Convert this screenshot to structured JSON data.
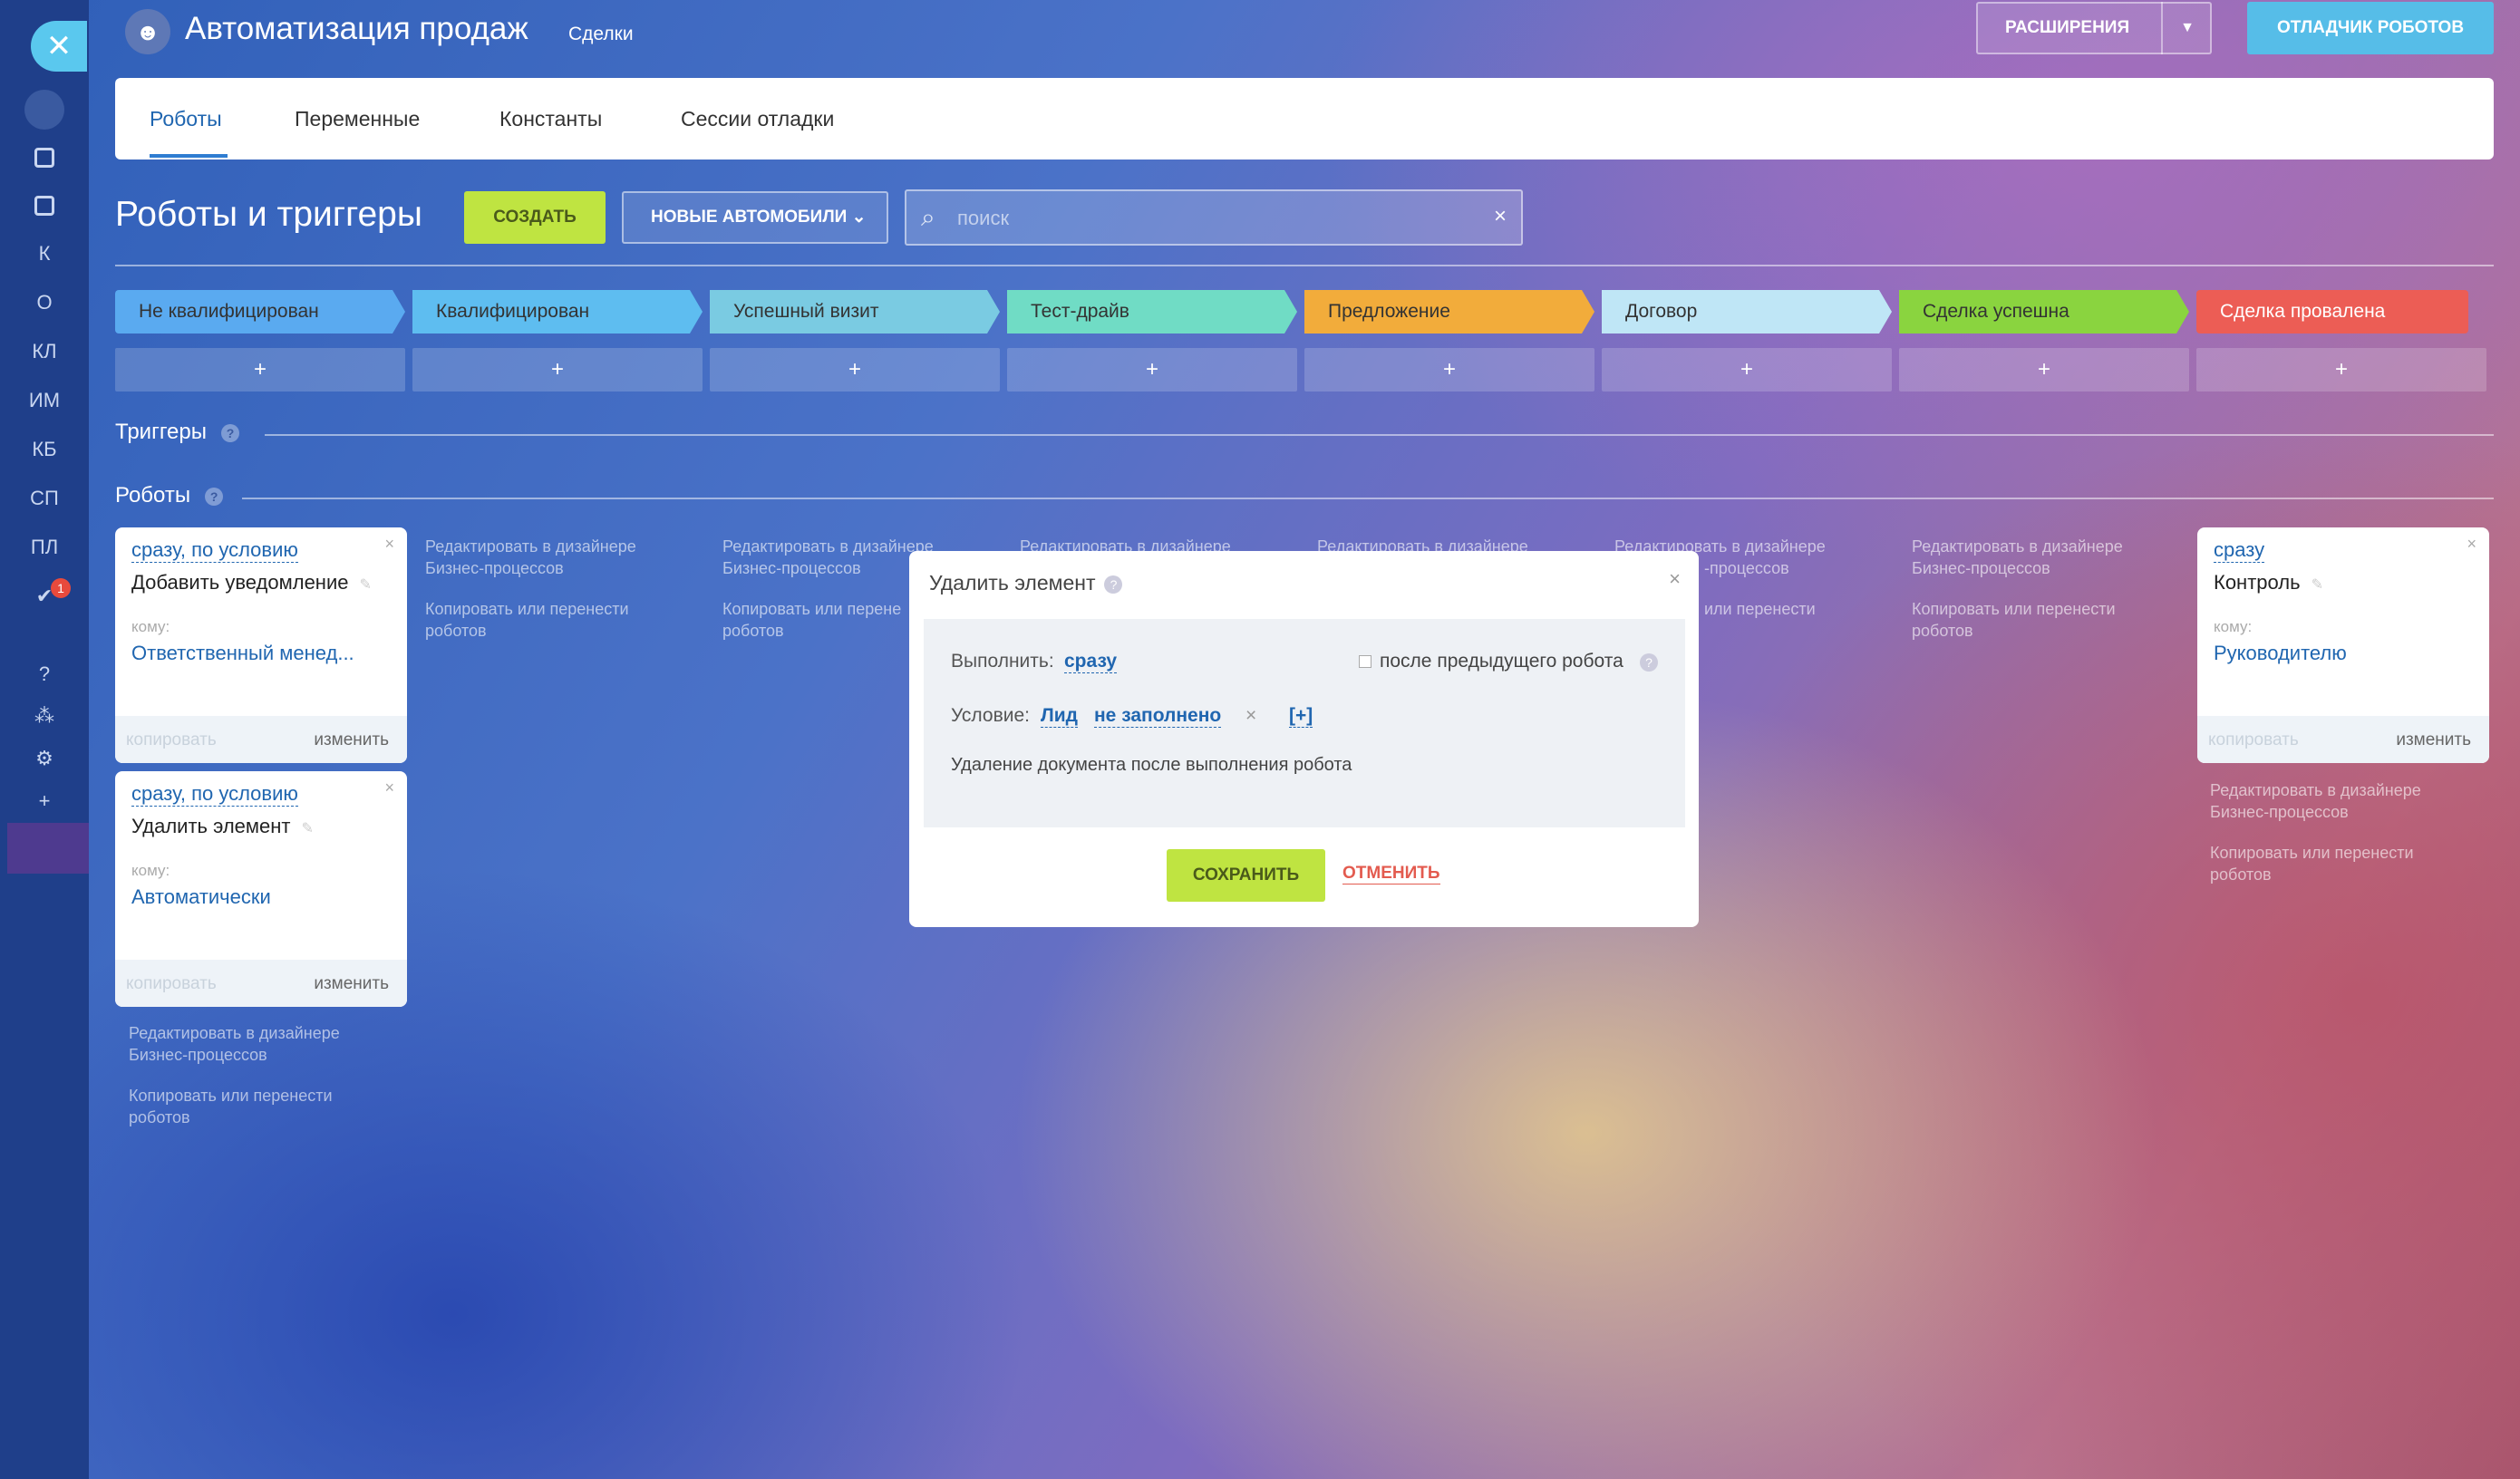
{
  "header": {
    "title": "Автоматизация продаж",
    "subtitle": "Сделки",
    "extensions_label": "РАСШИРЕНИЯ",
    "debugger_label": "ОТЛАДЧИК РОБОТОВ"
  },
  "sidebar": {
    "items": [
      "К",
      "О",
      "КЛ",
      "ИМ",
      "КБ",
      "СП",
      "ПЛ"
    ],
    "badge": "1"
  },
  "tabs": [
    {
      "label": "Роботы",
      "active": true
    },
    {
      "label": "Переменные",
      "active": false
    },
    {
      "label": "Константы",
      "active": false
    },
    {
      "label": "Сессии отладки",
      "active": false
    }
  ],
  "toolbar": {
    "section_title": "Роботы и триггеры",
    "create_label": "СОЗДАТЬ",
    "pipeline_label": "НОВЫЕ АВТОМОБИЛИ",
    "search_placeholder": "поиск"
  },
  "stages": [
    {
      "label": "Не квалифицирован",
      "color": "#5aaaf0"
    },
    {
      "label": "Квалифицирован",
      "color": "#5ebdf0"
    },
    {
      "label": "Успешный визит",
      "color": "#7acbe2"
    },
    {
      "label": "Тест-драйв",
      "color": "#70dcc5"
    },
    {
      "label": "Предложение",
      "color": "#f2ac3b"
    },
    {
      "label": "Договор",
      "color": "#bfe6f6"
    },
    {
      "label": "Сделка успешна",
      "color": "#8ad43f"
    },
    {
      "label": "Сделка провалена",
      "color": "#ec5d55"
    }
  ],
  "add_symbol": "+",
  "triggers_label": "Триггеры",
  "robots_label": "Роботы",
  "robots": [
    {
      "condition": "сразу, по условию",
      "name": "Добавить уведомление",
      "to_label": "кому:",
      "to": "Ответственный менед...",
      "copy": "копировать",
      "edit": "изменить"
    },
    {
      "condition": "сразу, по условию",
      "name": "Удалить элемент",
      "to_label": "кому:",
      "to": "Автоматически",
      "copy": "копировать",
      "edit": "изменить"
    },
    {
      "condition": "сразу",
      "name": "Контроль",
      "to_label": "кому:",
      "to": "Руководителю",
      "copy": "копировать",
      "edit": "изменить"
    }
  ],
  "column_links": {
    "edit_designer": "Редактировать в дизайнере Бизнес-процессов",
    "copy_move": "Копировать или перенести роботов",
    "edit_designer_partial": "Редактировать в дизайнере",
    "designer_tail": "-процессов",
    "copy_tail": "или перенести",
    "copy_partial": "Копировать или перене"
  },
  "modal": {
    "title": "Удалить элемент",
    "run_label": "Выполнить:",
    "run_value": "сразу",
    "after_prev_label": "после предыдущего робота",
    "condition_label": "Условие:",
    "condition_field": "Лид",
    "condition_value": "не заполнено",
    "condition_remove": "×",
    "condition_add": "[+]",
    "description": "Удаление документа после выполнения робота",
    "save_label": "СОХРАНИТЬ",
    "cancel_label": "ОТМЕНИТЬ"
  }
}
